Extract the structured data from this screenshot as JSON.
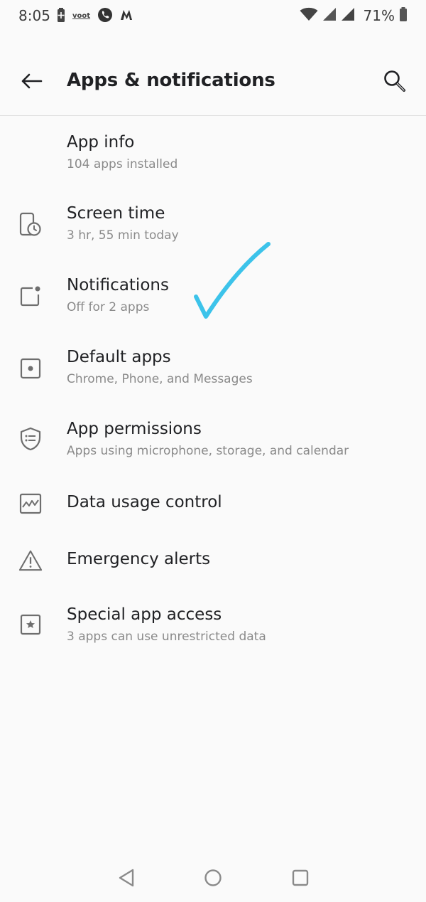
{
  "status_bar": {
    "time": "8:05",
    "voot_label": "voot",
    "battery_percent": "71%"
  },
  "app_bar": {
    "title": "Apps & notifications"
  },
  "items": [
    {
      "title": "App info",
      "subtitle": "104 apps installed",
      "icon": "none"
    },
    {
      "title": "Screen time",
      "subtitle": "3 hr, 55 min today",
      "icon": "screen-time-icon"
    },
    {
      "title": "Notifications",
      "subtitle": "Off for 2 apps",
      "icon": "notification-icon"
    },
    {
      "title": "Default apps",
      "subtitle": "Chrome, Phone, and Messages",
      "icon": "default-apps-icon"
    },
    {
      "title": "App permissions",
      "subtitle": "Apps using microphone, storage, and calendar",
      "icon": "shield-list-icon"
    },
    {
      "title": "Data usage control",
      "subtitle": "",
      "icon": "data-usage-icon"
    },
    {
      "title": "Emergency alerts",
      "subtitle": "",
      "icon": "warning-icon"
    },
    {
      "title": "Special app access",
      "subtitle": "3 apps can use unrestricted data",
      "icon": "star-box-icon"
    }
  ],
  "annotation": {
    "checkmark_color": "#3cc3ea"
  },
  "colors": {
    "background": "#fafafa",
    "title_text": "#202124",
    "secondary_text": "#8a8a8a",
    "icon_gray": "#6e6e6e"
  }
}
